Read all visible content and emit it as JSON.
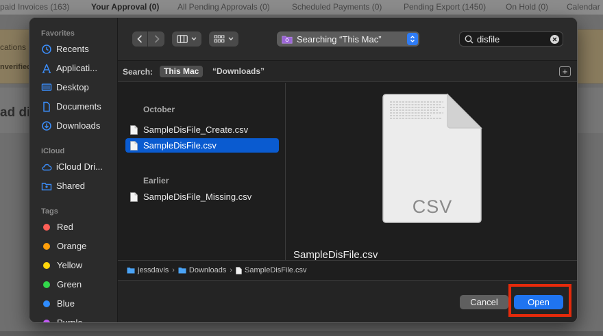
{
  "background": {
    "tabs": [
      {
        "label": "paid Invoices (163)"
      },
      {
        "label": "Your Approval (0)"
      },
      {
        "label": "All Pending Approvals (0)"
      },
      {
        "label": "Scheduled Payments (0)"
      },
      {
        "label": "Pending Export (1450)"
      },
      {
        "label": "On Hold (0)"
      },
      {
        "label": "Calendar"
      }
    ],
    "band_text_1": "cations",
    "band_text_2": "nverified",
    "heading": "ad di"
  },
  "sidebar": {
    "favorites_title": "Favorites",
    "favorites": [
      {
        "label": "Recents",
        "icon": "clock-icon"
      },
      {
        "label": "Applicati...",
        "icon": "applications-icon"
      },
      {
        "label": "Desktop",
        "icon": "desktop-icon"
      },
      {
        "label": "Documents",
        "icon": "document-icon"
      },
      {
        "label": "Downloads",
        "icon": "download-icon"
      }
    ],
    "icloud_title": "iCloud",
    "icloud": [
      {
        "label": "iCloud Dri...",
        "icon": "cloud-icon"
      },
      {
        "label": "Shared",
        "icon": "shared-folder-icon"
      }
    ],
    "tags_title": "Tags",
    "tags": [
      {
        "label": "Red",
        "color": "#ff5f57"
      },
      {
        "label": "Orange",
        "color": "#ff9f0a"
      },
      {
        "label": "Yellow",
        "color": "#ffd60a"
      },
      {
        "label": "Green",
        "color": "#32d74b"
      },
      {
        "label": "Blue",
        "color": "#2f8cff"
      },
      {
        "label": "Purple",
        "color": "#bf5af2"
      }
    ]
  },
  "toolbar": {
    "location_label": "Searching “This Mac”",
    "search_value": "disfile"
  },
  "scope": {
    "title": "Search:",
    "this_mac": "This Mac",
    "downloads": "“Downloads”"
  },
  "results": {
    "groups": [
      {
        "title": "October",
        "files": [
          "SampleDisFile_Create.csv",
          "SampleDisFile.csv"
        ]
      },
      {
        "title": "Earlier",
        "files": [
          "SampleDisFile_Missing.csv"
        ]
      }
    ],
    "selected": "SampleDisFile.csv"
  },
  "preview": {
    "type_label": "CSV",
    "file_name": "SampleDisFile.csv"
  },
  "pathbar": {
    "crumbs": [
      "jessdavis",
      "Downloads",
      "SampleDisFile.csv"
    ]
  },
  "buttons": {
    "cancel": "Cancel",
    "open": "Open"
  },
  "colors": {
    "accent": "#1f74f0",
    "selection": "#0a5bd0",
    "highlight": "#e52a0b"
  }
}
